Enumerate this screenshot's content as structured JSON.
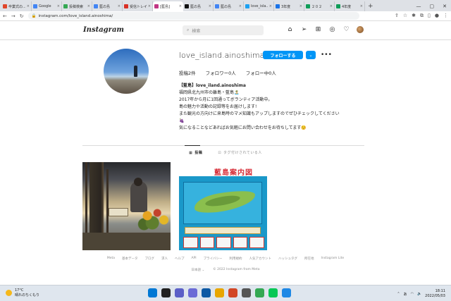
{
  "browser": {
    "tabs": [
      {
        "title": "卒業式の...",
        "color": "#e0462b",
        "active": false
      },
      {
        "title": "Google",
        "color": "#4285f4",
        "active": false
      },
      {
        "title": "投稿検索",
        "color": "#34a853",
        "active": false
      },
      {
        "title": "藍の島",
        "color": "#4285f4",
        "active": false
      },
      {
        "title": "受信トレイ",
        "color": "#d93025",
        "active": false
      },
      {
        "title": "[藍島]",
        "color": "#c13584",
        "active": true
      },
      {
        "title": "藍の島",
        "color": "#111111",
        "active": false
      },
      {
        "title": "藍の島",
        "color": "#4285f4",
        "active": false
      },
      {
        "title": "love_isla...",
        "color": "#1da1f2",
        "active": false
      },
      {
        "title": "3年度",
        "color": "#1a73e8",
        "active": false
      },
      {
        "title": "２０２",
        "color": "#0f9d58",
        "active": false
      },
      {
        "title": "4年度",
        "color": "#0f9d58",
        "active": false
      }
    ],
    "new_tab": "+",
    "url": "instagram.com/love_island.ainoshima/"
  },
  "ig": {
    "logo": "Instagram",
    "search_placeholder": "検索",
    "username": "love_island.ainoshima",
    "follow_label": "フォローする",
    "dropdown": "⌄",
    "more": "•••",
    "stats": [
      "投稿2件",
      "フォロワー0人",
      "フォロー中0人"
    ],
    "bio": {
      "name": "【藍島】love_iland.ainoshima",
      "lines": [
        "福岡県北九州市の離島・藍島🏝️",
        "2017年から月に1回通ってボランティア活動中。",
        "島の魅力や活動の記録等をお届けします!",
        "また観光の方向けに来島時のマメ知識もアップしますのでぜひチェックしてください",
        "🍇",
        "気になることなどあればお気軽にお問い合わせをお待ちしてます☺️"
      ]
    },
    "profile_tabs": {
      "posts": "投稿",
      "tagged": "タグ付けされている人"
    },
    "post2_title": "藍島案内図",
    "footer_links": [
      "Meta",
      "基本データ",
      "ブログ",
      "求人",
      "ヘルプ",
      "API",
      "プライバシー",
      "利用規約",
      "人気アカウント",
      "ハッシュタグ",
      "所在地",
      "Instagram Lite"
    ],
    "language": "日本語 ⌄",
    "copyright": "© 2022 Instagram from Meta"
  },
  "taskbar": {
    "temp": "17°C",
    "weather": "晴れのちくもり",
    "time": "18:11",
    "date": "2022/05/03",
    "lang": "あ",
    "apps": [
      "#0078d4",
      "#202020",
      "#5b5fc7",
      "#6b6bd6",
      "#0c59a4",
      "#e8a600",
      "#d24726",
      "#555555",
      "#34a853",
      "#06c755",
      "#1e88e5"
    ]
  }
}
